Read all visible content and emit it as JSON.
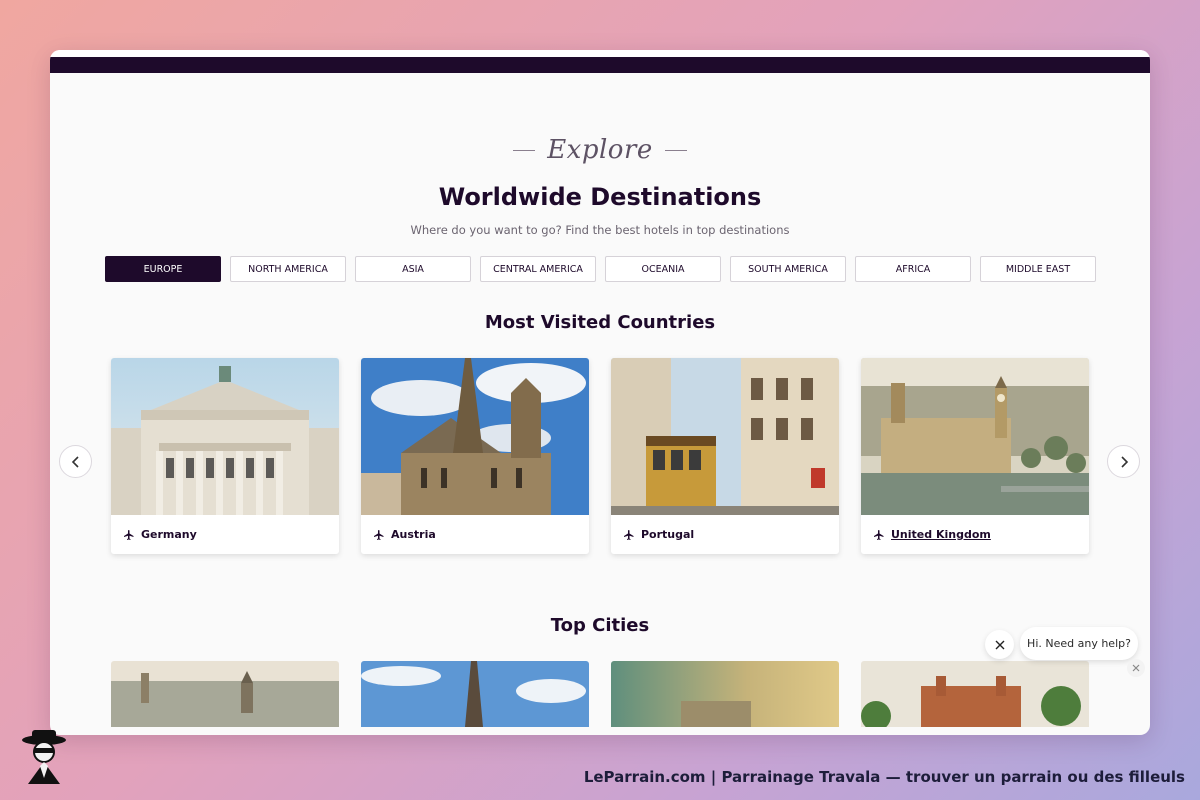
{
  "header": {
    "kicker": "Explore",
    "title": "Worldwide Destinations",
    "subtitle": "Where do you want to go? Find the best hotels in top destinations"
  },
  "tabs": [
    "EUROPE",
    "NORTH AMERICA",
    "ASIA",
    "CENTRAL AMERICA",
    "OCEANIA",
    "SOUTH AMERICA",
    "AFRICA",
    "MIDDLE EAST"
  ],
  "active_tab": "EUROPE",
  "countries_section": {
    "title": "Most Visited Countries"
  },
  "countries": [
    {
      "name": "Germany",
      "icon": "plane-icon"
    },
    {
      "name": "Austria",
      "icon": "plane-icon"
    },
    {
      "name": "Portugal",
      "icon": "plane-icon"
    },
    {
      "name": "United Kingdom",
      "icon": "plane-icon"
    }
  ],
  "cities_section": {
    "title": "Top Cities"
  },
  "chat": {
    "message": "Hi. Need any help?"
  },
  "footer": {
    "text": "LeParrain.com | Parrainage Travala — trouver un parrain ou des filleuls"
  },
  "colors": {
    "brand_dark": "#1e0a2b",
    "page_bg": "#fafafa"
  }
}
